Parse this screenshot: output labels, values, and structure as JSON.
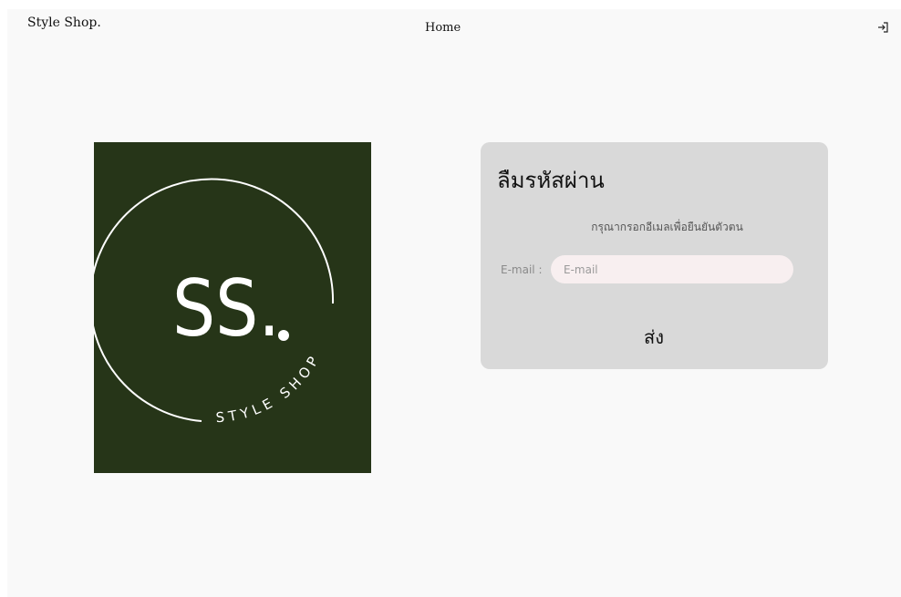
{
  "header": {
    "brand": "Style Shop.",
    "nav_home": "Home",
    "login_icon": "sign-in-icon"
  },
  "logo": {
    "monogram": "SS.",
    "curved_text": "STYLE SHOP",
    "background_color": "#263518",
    "foreground_color": "#ffffff"
  },
  "form": {
    "title": "ลืมรหัสผ่าน",
    "subtitle": "กรุณากรอกอีเมลเพื่อยืนยันตัวตน",
    "email_label": "E-mail :",
    "email_placeholder": "E-mail",
    "email_value": "",
    "submit_label": "ส่ง",
    "card_color": "#d9d9d9",
    "input_color": "#f8eff0"
  }
}
